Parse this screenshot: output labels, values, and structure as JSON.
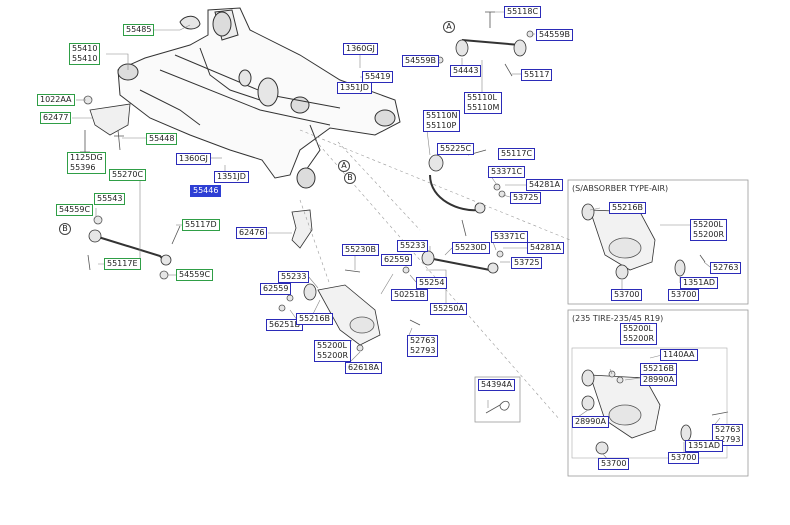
{
  "colors": {
    "label_border": "#2b2bb8",
    "label_border_alt": "#2f9e46",
    "selected_fill": "#2e3fd4",
    "line": "#555555"
  },
  "labels": {
    "l55485": "55485",
    "l55410a": "55410",
    "l55410b": "55410",
    "l1022AA": "1022AA",
    "l62477": "62477",
    "l55448": "55448",
    "l1125DG": "1125DG",
    "l55396": "55396",
    "l1360GJ_a": "1360GJ",
    "l55419": "55419",
    "l1351JD_a": "1351JD",
    "l1360GJ_b": "1360GJ",
    "l1351JD_b": "1351JD",
    "l55446": "55446",
    "l55270C": "55270C",
    "l54559C_a": "54559C",
    "l55543": "55543",
    "l55117D": "55117D",
    "l55117E": "55117E",
    "l54559C_b": "54559C",
    "l62476": "62476",
    "l55118C": "55118C",
    "l54559B_a": "54559B",
    "l54559B_b": "54559B",
    "l54443": "54443",
    "l55117": "55117",
    "l55110L_a": "55110L",
    "l55110M": "55110M",
    "l55110N": "55110N",
    "l55110P": "55110P",
    "l55225C": "55225C",
    "l55117C": "55117C",
    "l53371C_a": "53371C",
    "l54281A_a": "54281A",
    "l53725_a": "53725",
    "l55230B": "55230B",
    "l55233_a": "55233",
    "l55230D": "55230D",
    "l53371C_b": "53371C",
    "l54281A_b": "54281A",
    "l62559_a": "62559",
    "l55254": "55254",
    "l53725_b": "53725",
    "l50251B": "50251B",
    "l55233_b": "55233",
    "l62559_b": "62559",
    "l55250A": "55250A",
    "l56251B": "56251B",
    "l55216B_a": "55216B",
    "l52763_a": "52763",
    "l52793_a": "52793",
    "l55200L_a": "55200L",
    "l55200R_a": "55200R",
    "l62618A": "62618A",
    "l54394A": "54394A",
    "l55216B_b": "55216B",
    "l55200L_b": "55200L",
    "l55200R_b": "55200R",
    "l52763_b": "52763",
    "l53700_a": "53700",
    "l53700_b": "53700",
    "l1351AD_a": "1351AD",
    "l55200L_c": "55200L",
    "l55200R_c": "55200R",
    "l1140AA": "1140AA",
    "l55216B_c": "55216B",
    "l28990A_a": "28990A",
    "l28990A_b": "28990A",
    "l52763_c": "52763",
    "l52793_c": "52793",
    "l1351AD_b": "1351AD",
    "l53700_c": "53700",
    "l53700_d": "53700"
  },
  "boxes": {
    "air_title": "(S/ABSORBER TYPE-AIR)",
    "tire_title": "(235 TIRE-235/45 R19)"
  },
  "callouts": {
    "A": "A",
    "B": "B"
  }
}
